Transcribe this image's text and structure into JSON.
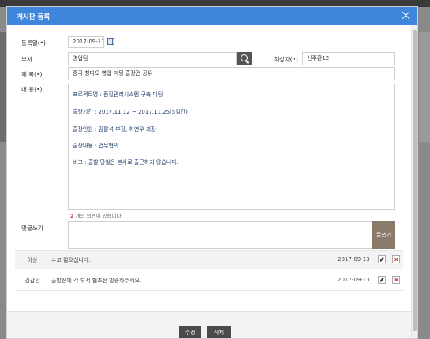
{
  "modal": {
    "title": "게시판 등록"
  },
  "form": {
    "date_label": "등록일(•)",
    "date_value": "2017-09-13",
    "dept_label": "부서",
    "dept_value": "영업팀",
    "writer_label": "작성자(•)",
    "writer_value": "신주환12",
    "subject_label": "제 목(•)",
    "subject_value": "중국 칭따오 영업 미팅 출장건 공유",
    "content_label": "내 용(•)",
    "content_lines": [
      "프로젝트명 : 품질관리시스템 구축 미팅",
      "출장기간 : 2017.11.12 ~ 2017.11.25(5일간)",
      "출장인원 : 김팔석 부장, 하연우 과장",
      "출장내용 : 업무협의",
      "비고 : 출발 당일은 본사로 출근하지 않습니다."
    ]
  },
  "opinion": {
    "count": "2",
    "suffix": "개의 의견이 있습니다."
  },
  "comment": {
    "label": "댓글쓰기",
    "button": "글쓰기"
  },
  "comments": [
    {
      "author": "이상",
      "text": "수고 많으십니다.",
      "date": "2017-09-13"
    },
    {
      "author": "김갑환",
      "text": "출발전에 각 부서 협조전 발송하주세요.",
      "date": "2017-09-13"
    }
  ],
  "footer": {
    "edit_button": "수정",
    "delete_button": "삭제"
  },
  "icons": {
    "close": "close-icon",
    "calendar": "calendar-icon",
    "search": "search-icon",
    "edit": "pencil-icon",
    "delete": "delete-x-icon"
  },
  "colors": {
    "header": "#3d86dc",
    "comment_button": "#8a7a6a",
    "footer_button": "#4a4a4a",
    "opinion_count": "#d23a3a"
  }
}
